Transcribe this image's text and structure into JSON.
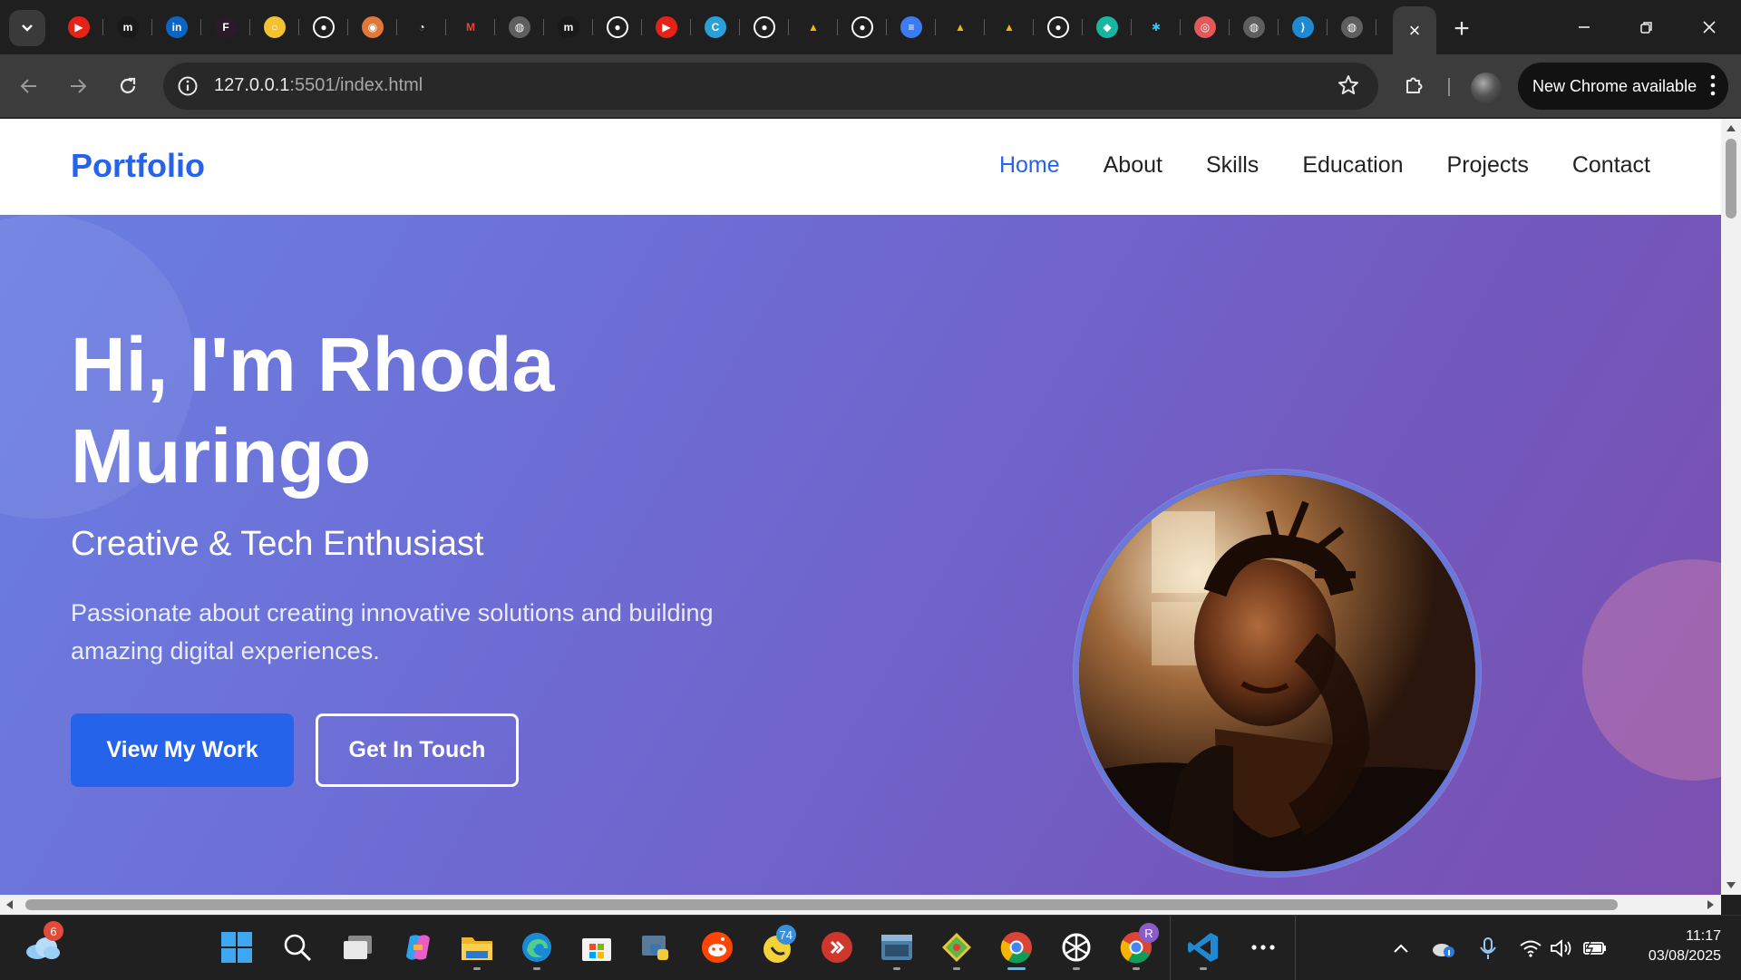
{
  "browser": {
    "tab_favicons": [
      "youtube-icon",
      "medium-icon",
      "linkedin-icon",
      "figma-icon",
      "circle-app-icon",
      "github-icon",
      "chatgpt-orange-icon",
      "speed-icon",
      "gmail-icon",
      "globe-icon",
      "medium-icon",
      "github-icon",
      "youtube-icon",
      "canva-icon",
      "github-icon",
      "google-drive-icon",
      "github-icon",
      "google-docs-icon",
      "google-drive-icon",
      "google-drive-icon",
      "github-icon",
      "diamond-app-icon",
      "slack-icon",
      "record-icon",
      "globe-icon",
      "vscode-icon",
      "globe-icon"
    ],
    "active_tab_close": "×",
    "new_tab": "+",
    "url_host": "127.0.0.1",
    "url_rest": ":5501/index.html",
    "update_button": "New Chrome available"
  },
  "site": {
    "brand": "Portfolio",
    "nav": [
      "Home",
      "About",
      "Skills",
      "Education",
      "Projects",
      "Contact"
    ],
    "hero": {
      "title": "Hi, I'm Rhoda Muringo",
      "subtitle": "Creative & Tech Enthusiast",
      "description": "Passionate about creating innovative solutions and building amazing digital experiences.",
      "primary_button": "View My Work",
      "secondary_button": "Get In Touch"
    }
  },
  "taskbar": {
    "weather_badge": "6",
    "whatsapp_badge": "74",
    "chrome_profile_badge": "R",
    "time": "11:17",
    "date": "03/08/2025",
    "apps": [
      "windows-start-icon",
      "search-icon",
      "task-view-icon",
      "copilot-icon",
      "file-explorer-icon",
      "edge-icon",
      "microsoft-store-icon",
      "python-icon",
      "reddit-icon",
      "whatsapp-icon",
      "anydesk-icon",
      "terminal-icon",
      "git-icon",
      "chrome-icon",
      "chatgpt-icon",
      "chrome-profile-icon",
      "vscode-icon",
      "more-icon"
    ]
  }
}
